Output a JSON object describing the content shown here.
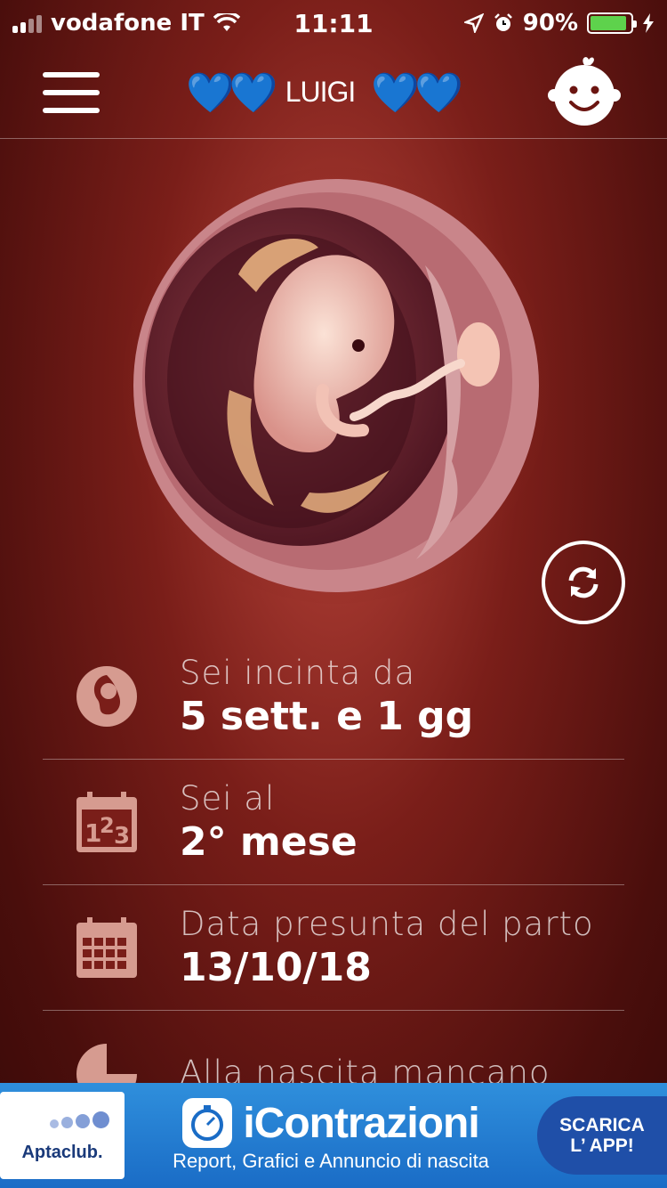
{
  "status_bar": {
    "carrier": "vodafone IT",
    "time": "11:11",
    "battery_percent": "90%",
    "battery_level": 0.9
  },
  "header": {
    "hearts_left": "💙💙",
    "name": "LUIGI",
    "hearts_right": "💙💙"
  },
  "info": [
    {
      "label": "Sei incinta da",
      "value": "5 sett. e 1 gg",
      "icon": "embryo-circle-icon"
    },
    {
      "label": "Sei al",
      "value": "2° mese",
      "icon": "calendar-123-icon"
    },
    {
      "label": "Data presunta del parto",
      "value": "13/10/18",
      "icon": "calendar-grid-icon"
    },
    {
      "label": "Alla nascita mancano",
      "value": "",
      "icon": "pie-chart-icon"
    }
  ],
  "ad": {
    "brand": "Aptaclub.",
    "title": "iContrazioni",
    "subtitle": "Report, Grafici e Annuncio di nascita",
    "cta_line1": "SCARICA",
    "cta_line2": "L’ APP!"
  },
  "colors": {
    "background": "#7a1e19",
    "heart": "#2f6cf0",
    "ad_background": "#2f8fdc",
    "battery": "#5ed24c"
  }
}
